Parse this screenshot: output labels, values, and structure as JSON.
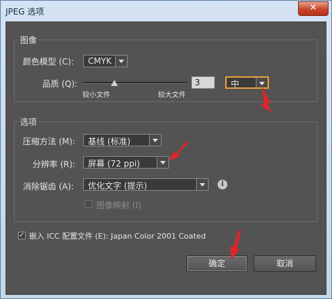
{
  "window": {
    "title": "JPEG 选项",
    "close_glyph": "✕"
  },
  "image_group": {
    "legend": "图像",
    "color_model_label": "颜色模型 (C):",
    "color_model_value": "CMYK",
    "quality_label": "品质 (Q):",
    "quality_value": "3",
    "quality_level": "中",
    "slider_min_label": "较小文件",
    "slider_max_label": "较大文件",
    "slider_fraction": 0.3
  },
  "options_group": {
    "legend": "选项",
    "compression_label": "压缩方法 (M):",
    "compression_value": "基线 (标准)",
    "resolution_label": "分辨率 (R):",
    "resolution_value": "屏幕 (72 ppi)",
    "antialias_label": "消除锯齿 (A):",
    "antialias_value": "优化文字 (提示)",
    "imagemap_label": "图像映射 (I)",
    "imagemap_checked": false
  },
  "embed_icc": {
    "checked": true,
    "check_glyph": "✓",
    "label": "嵌入 ICC 配置文件 (E): Japan Color 2001 Coated"
  },
  "buttons": {
    "ok": "确定",
    "cancel": "取消"
  },
  "info_glyph": "i",
  "colors": {
    "annotation_arrow": "#e0242b",
    "highlight_border": "#e8a23a",
    "panel_bg": "#535353"
  }
}
